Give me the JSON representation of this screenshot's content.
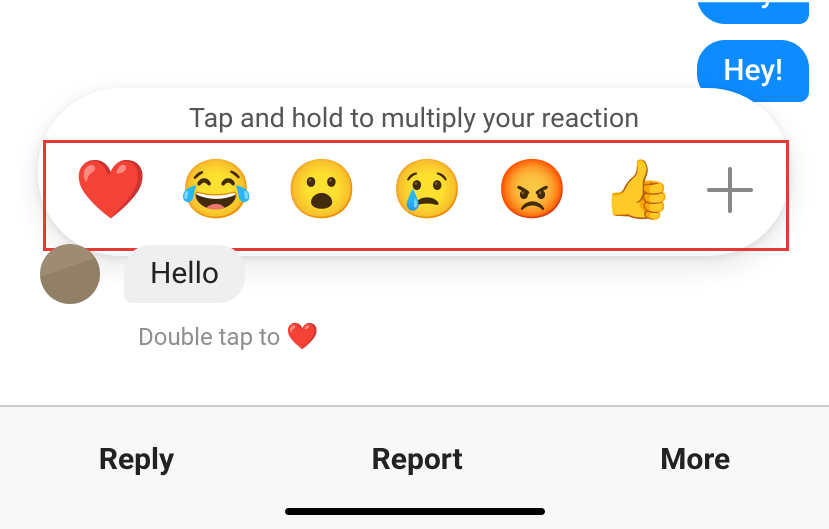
{
  "messages": {
    "out_partial": "Hey!",
    "out": "Hey!",
    "in": "Hello"
  },
  "reactions": {
    "hint": "Tap and hold to multiply your reaction",
    "items": {
      "heart": "❤️",
      "laugh": "😂",
      "wow": "😮",
      "sad": "😢",
      "angry": "😡",
      "like": "👍"
    }
  },
  "double_tap_hint": {
    "text": "Double tap to",
    "icon": "❤️"
  },
  "actions": {
    "reply": "Reply",
    "report": "Report",
    "more": "More"
  }
}
